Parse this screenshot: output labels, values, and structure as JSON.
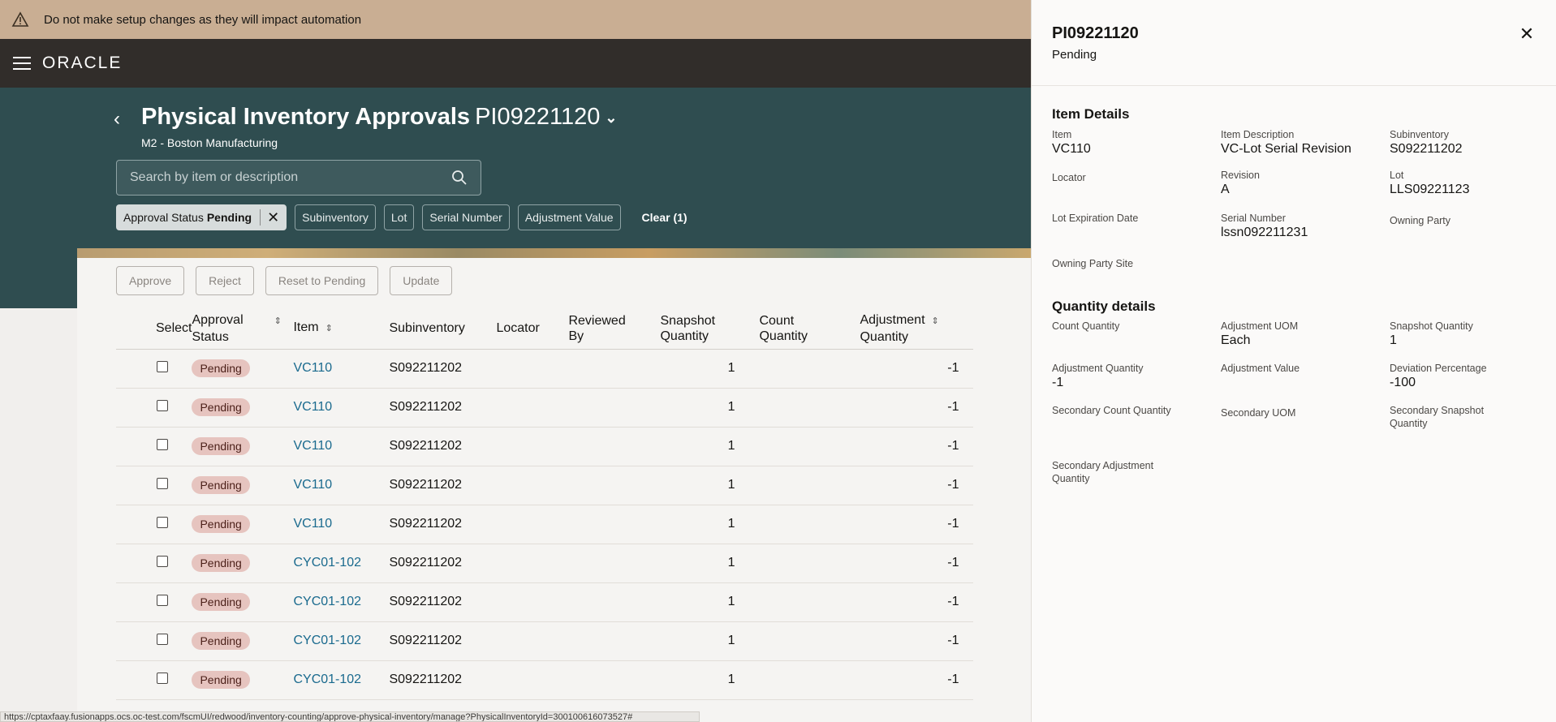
{
  "banner": {
    "text": "Do not make setup changes as they will impact automation"
  },
  "header": {
    "logo": "ORACLE"
  },
  "page": {
    "title": "Physical Inventory Approvals",
    "title_id": "PI09221120",
    "org": "M2 - Boston Manufacturing",
    "search_placeholder": "Search by item or description"
  },
  "filters": {
    "approval_label": "Approval Status",
    "approval_value": "Pending",
    "chips": [
      "Subinventory",
      "Lot",
      "Serial Number",
      "Adjustment Value"
    ],
    "clear": "Clear (1)"
  },
  "toolbar": {
    "approve": "Approve",
    "reject": "Reject",
    "reset": "Reset to Pending",
    "update": "Update"
  },
  "table": {
    "headers": {
      "select": "Select",
      "approval_status_1": "Approval",
      "approval_status_2": "Status",
      "item": "Item",
      "subinventory": "Subinventory",
      "locator": "Locator",
      "reviewed_1": "Reviewed",
      "reviewed_2": "By",
      "snapshot_1": "Snapshot",
      "snapshot_2": "Quantity",
      "count_1": "Count",
      "count_2": "Quantity",
      "adj_1": "Adjustment",
      "adj_2": "Quantity"
    },
    "rows": [
      {
        "status": "Pending",
        "item": "VC110",
        "sub": "S092211202",
        "snapshot": "1",
        "adj": "-1"
      },
      {
        "status": "Pending",
        "item": "VC110",
        "sub": "S092211202",
        "snapshot": "1",
        "adj": "-1"
      },
      {
        "status": "Pending",
        "item": "VC110",
        "sub": "S092211202",
        "snapshot": "1",
        "adj": "-1"
      },
      {
        "status": "Pending",
        "item": "VC110",
        "sub": "S092211202",
        "snapshot": "1",
        "adj": "-1"
      },
      {
        "status": "Pending",
        "item": "VC110",
        "sub": "S092211202",
        "snapshot": "1",
        "adj": "-1"
      },
      {
        "status": "Pending",
        "item": "CYC01-102",
        "sub": "S092211202",
        "snapshot": "1",
        "adj": "-1"
      },
      {
        "status": "Pending",
        "item": "CYC01-102",
        "sub": "S092211202",
        "snapshot": "1",
        "adj": "-1"
      },
      {
        "status": "Pending",
        "item": "CYC01-102",
        "sub": "S092211202",
        "snapshot": "1",
        "adj": "-1"
      },
      {
        "status": "Pending",
        "item": "CYC01-102",
        "sub": "S092211202",
        "snapshot": "1",
        "adj": "-1"
      }
    ]
  },
  "statusbar": {
    "url": "https://cptaxfaay.fusionapps.ocs.oc-test.com/fscmUI/redwood/inventory-counting/approve-physical-inventory/manage?PhysicalInventoryId=300100616073527#"
  },
  "drawer": {
    "id": "PI09221120",
    "status": "Pending",
    "item_details_title": "Item Details",
    "item_label": "Item",
    "item_value": "VC110",
    "desc_label": "Item Description",
    "desc_value": "VC-Lot Serial Revision",
    "sub_label": "Subinventory",
    "sub_value": "S092211202",
    "locator_label": "Locator",
    "rev_label": "Revision",
    "rev_value": "A",
    "lot_label": "Lot",
    "lot_value": "LLS09221123",
    "lotexp_label": "Lot Expiration Date",
    "serial_label": "Serial Number",
    "serial_value": "lssn092211231",
    "owning_label": "Owning Party",
    "owning_site_label": "Owning Party Site",
    "qty_title": "Quantity details",
    "count_qty_label": "Count Quantity",
    "adj_uom_label": "Adjustment UOM",
    "adj_uom_value": "Each",
    "snap_qty_label": "Snapshot Quantity",
    "snap_qty_value": "1",
    "adj_qty_label": "Adjustment Quantity",
    "adj_qty_value": "-1",
    "adj_val_label": "Adjustment Value",
    "dev_label": "Deviation Percentage",
    "dev_value": "-100",
    "sec_count_label": "Secondary Count Quantity",
    "sec_uom_label": "Secondary UOM",
    "sec_snap_label_1": "Secondary Snapshot",
    "sec_snap_label_2": "Quantity",
    "sec_adj_label_1": "Secondary Adjustment",
    "sec_adj_label_2": "Quantity"
  }
}
